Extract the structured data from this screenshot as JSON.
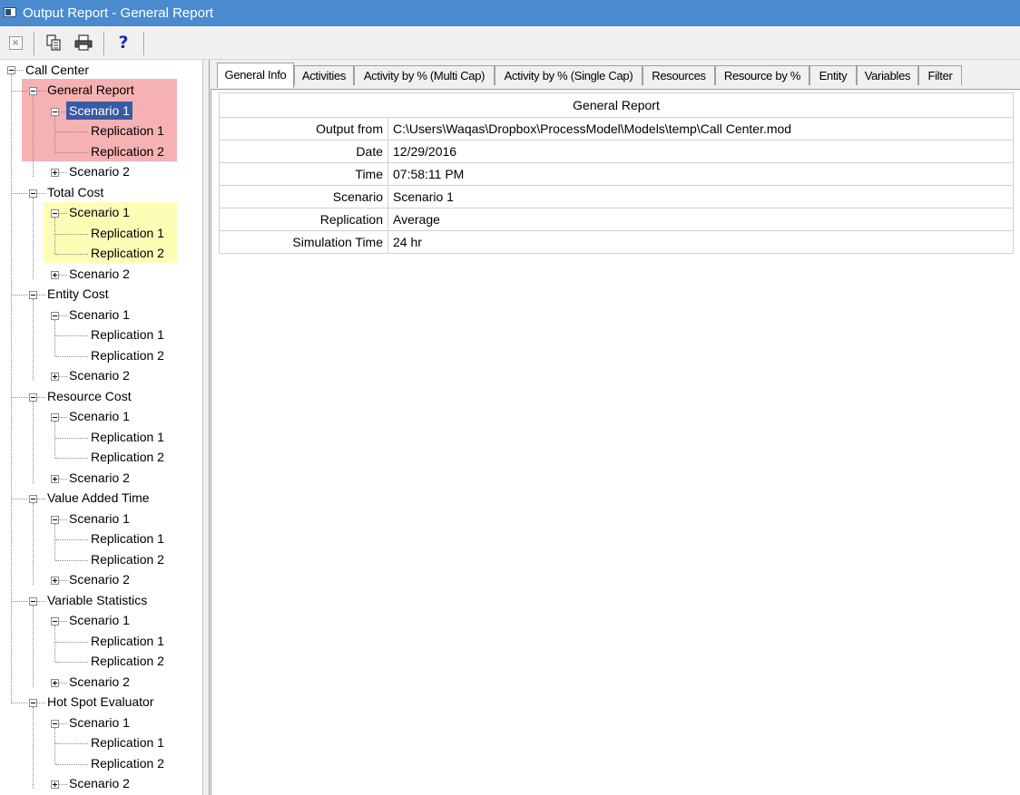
{
  "window": {
    "title": "Output Report - General Report"
  },
  "toolbar": {
    "buttons": [
      {
        "name": "close-report",
        "icon": "close-x-icon"
      },
      {
        "name": "copy",
        "icon": "copy-icon"
      },
      {
        "name": "print",
        "icon": "printer-icon"
      },
      {
        "name": "help",
        "icon": "help-icon",
        "label": "?"
      }
    ]
  },
  "tree": {
    "root": "Call Center",
    "highlight_colors": {
      "general_report": "#f6b1b2",
      "total_cost": "#fdfdb6",
      "selected": "#3a5aa5"
    },
    "groups": [
      {
        "label": "General Report",
        "expanded": true,
        "scenario1": "Scenario 1",
        "rep1": "Replication 1",
        "rep2": "Replication 2",
        "scenario2": "Scenario 2"
      },
      {
        "label": "Total Cost",
        "expanded": true,
        "scenario1": "Scenario 1",
        "rep1": "Replication 1",
        "rep2": "Replication 2",
        "scenario2": "Scenario 2"
      },
      {
        "label": "Entity Cost",
        "expanded": true,
        "scenario1": "Scenario 1",
        "rep1": "Replication 1",
        "rep2": "Replication 2",
        "scenario2": "Scenario 2"
      },
      {
        "label": "Resource Cost",
        "expanded": true,
        "scenario1": "Scenario 1",
        "rep1": "Replication 1",
        "rep2": "Replication 2",
        "scenario2": "Scenario 2"
      },
      {
        "label": "Value Added Time",
        "expanded": true,
        "scenario1": "Scenario 1",
        "rep1": "Replication 1",
        "rep2": "Replication 2",
        "scenario2": "Scenario 2"
      },
      {
        "label": "Variable Statistics",
        "expanded": true,
        "scenario1": "Scenario 1",
        "rep1": "Replication 1",
        "rep2": "Replication 2",
        "scenario2": "Scenario 2"
      },
      {
        "label": "Hot Spot Evaluator",
        "expanded": true,
        "scenario1": "Scenario 1",
        "rep1": "Replication 1",
        "rep2": "Replication 2",
        "scenario2": "Scenario 2"
      }
    ]
  },
  "tabs": [
    {
      "label": "General Info",
      "active": true
    },
    {
      "label": "Activities"
    },
    {
      "label": "Activity by % (Multi Cap)"
    },
    {
      "label": "Activity by % (Single Cap)"
    },
    {
      "label": "Resources"
    },
    {
      "label": "Resource by %"
    },
    {
      "label": "Entity"
    },
    {
      "label": "Variables"
    },
    {
      "label": "Filter"
    }
  ],
  "report": {
    "heading": "General Report",
    "rows": [
      {
        "label": "Output from",
        "value": "C:\\Users\\Waqas\\Dropbox\\ProcessModel\\Models\\temp\\Call Center.mod"
      },
      {
        "label": "Date",
        "value": "12/29/2016"
      },
      {
        "label": "Time",
        "value": "07:58:11 PM"
      },
      {
        "label": "Scenario",
        "value": "Scenario 1"
      },
      {
        "label": "Replication",
        "value": "Average"
      },
      {
        "label": "Simulation Time",
        "value": "24 hr"
      }
    ]
  }
}
